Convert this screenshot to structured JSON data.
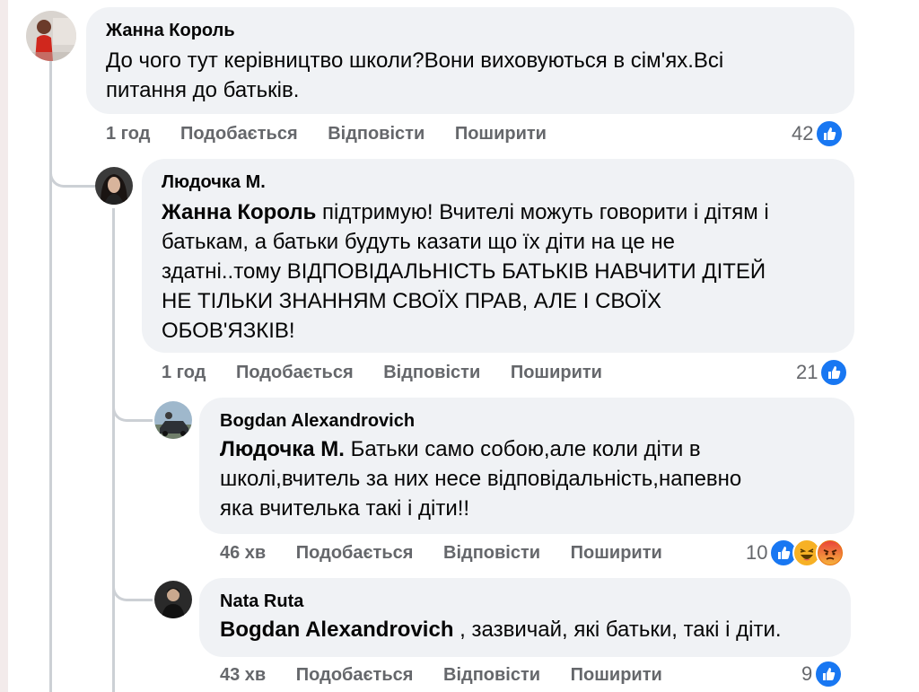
{
  "comments": [
    {
      "author": "Жанна Король",
      "text_lines": [
        "До чого тут керівництво школи?Вони виховуються в сім'ях.Всі",
        "питання до батьків."
      ],
      "time": "1 год",
      "actions": {
        "like": "Подобається",
        "reply": "Відповісти",
        "share": "Поширити"
      },
      "reaction_count": "42",
      "reactions": [
        "like-icon"
      ]
    },
    {
      "author": "Людочка М.",
      "mention": "Жанна Король",
      "text_lines": [
        " підтримую! Вчителі можуть говорити і дітям і",
        "батькам, а батьки будуть казати що їх діти на це не",
        "здатні..тому ВІДПОВІДАЛЬНІСТЬ БАТЬКІВ НАВЧИТИ ДІТЕЙ",
        "НЕ ТІЛЬКИ ЗНАННЯМ СВОЇХ ПРАВ, АЛЕ І СВОЇХ",
        "ОБОВ'ЯЗКІВ!"
      ],
      "time": "1 год",
      "actions": {
        "like": "Подобається",
        "reply": "Відповісти",
        "share": "Поширити"
      },
      "reaction_count": "21",
      "reactions": [
        "like-icon"
      ]
    },
    {
      "author": "Bogdan Alexandrovich",
      "mention": "Людочка М.",
      "text_lines": [
        " Батьки само собою,але коли діти в",
        "школі,вчитель за них несе відповідальність,напевно",
        "яка вчителька такі і діти!!"
      ],
      "time": "46 хв",
      "actions": {
        "like": "Подобається",
        "reply": "Відповісти",
        "share": "Поширити"
      },
      "reaction_count": "10",
      "reactions": [
        "like-icon",
        "haha-icon",
        "angry-icon"
      ]
    },
    {
      "author": "Nata Ruta",
      "mention": "Bogdan Alexandrovich",
      "text_lines": [
        " , зазвичай, які батьки, такі і діти."
      ],
      "time": "43 хв",
      "actions": {
        "like": "Подобається",
        "reply": "Відповісти",
        "share": "Поширити"
      },
      "reaction_count": "9",
      "reactions": [
        "like-icon"
      ]
    }
  ]
}
